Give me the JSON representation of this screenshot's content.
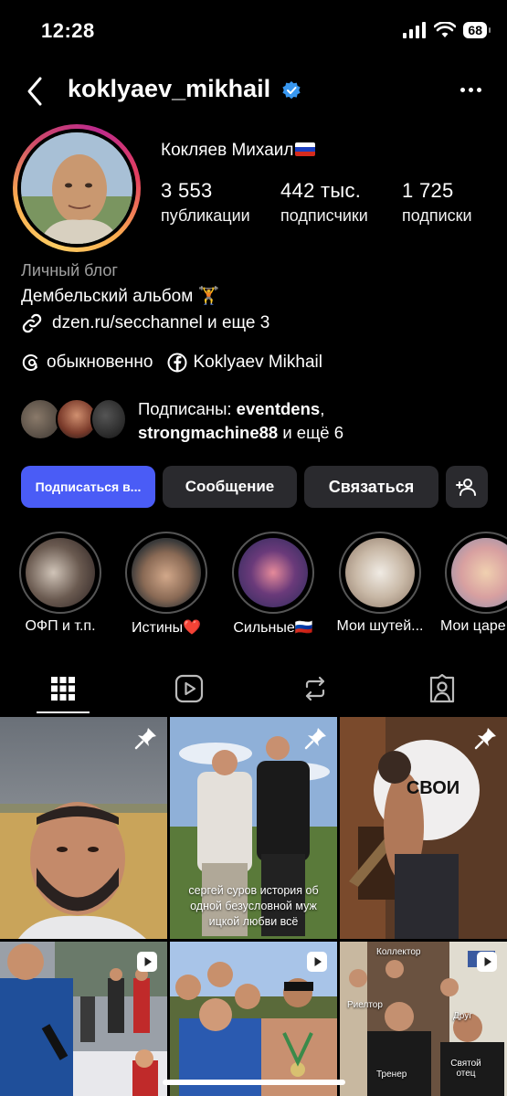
{
  "status": {
    "time": "12:28",
    "battery": "68"
  },
  "header": {
    "username": "koklyaev_mikhail"
  },
  "profile": {
    "fullname": "Кокляев Михаил",
    "stats": [
      {
        "value": "3 553",
        "label": "публикации"
      },
      {
        "value": "442 тыс.",
        "label": "подписчики"
      },
      {
        "value": "1 725",
        "label": "подписки"
      }
    ],
    "category": "Личный блог",
    "bio": "Дембельский альбом 🏋",
    "link": "dzen.ru/secchannel и еще 3",
    "threads": "обыкновенно",
    "facebook": "Koklyaev Mikhail",
    "followed_prefix": "Подписаны: ",
    "followed_1": "eventdens",
    "followed_sep": ",",
    "followed_2": "strongmachine88",
    "followed_suffix": " и ещё 6"
  },
  "buttons": {
    "follow": "Подписаться в...",
    "message": "Сообщение",
    "contact": "Связаться"
  },
  "highlights": [
    {
      "label": "ОФП и т.п."
    },
    {
      "label": "Истины❤️"
    },
    {
      "label": "Сильные🇷🇺"
    },
    {
      "label": "Мои шутей..."
    },
    {
      "label": "Мои царе"
    }
  ],
  "grid": {
    "post2_caption": "сергей суров история об одной безусловной муж ицкой любви всё",
    "post3_shirt": "СВОИ",
    "post6_labels": [
      "Коллектор",
      "Риелтор",
      "Друг",
      "Тренер",
      "Святой отец"
    ]
  },
  "colors": {
    "accent": "#4a5cf6",
    "verified": "#3897f0",
    "button_bg": "#2a2a2e"
  }
}
